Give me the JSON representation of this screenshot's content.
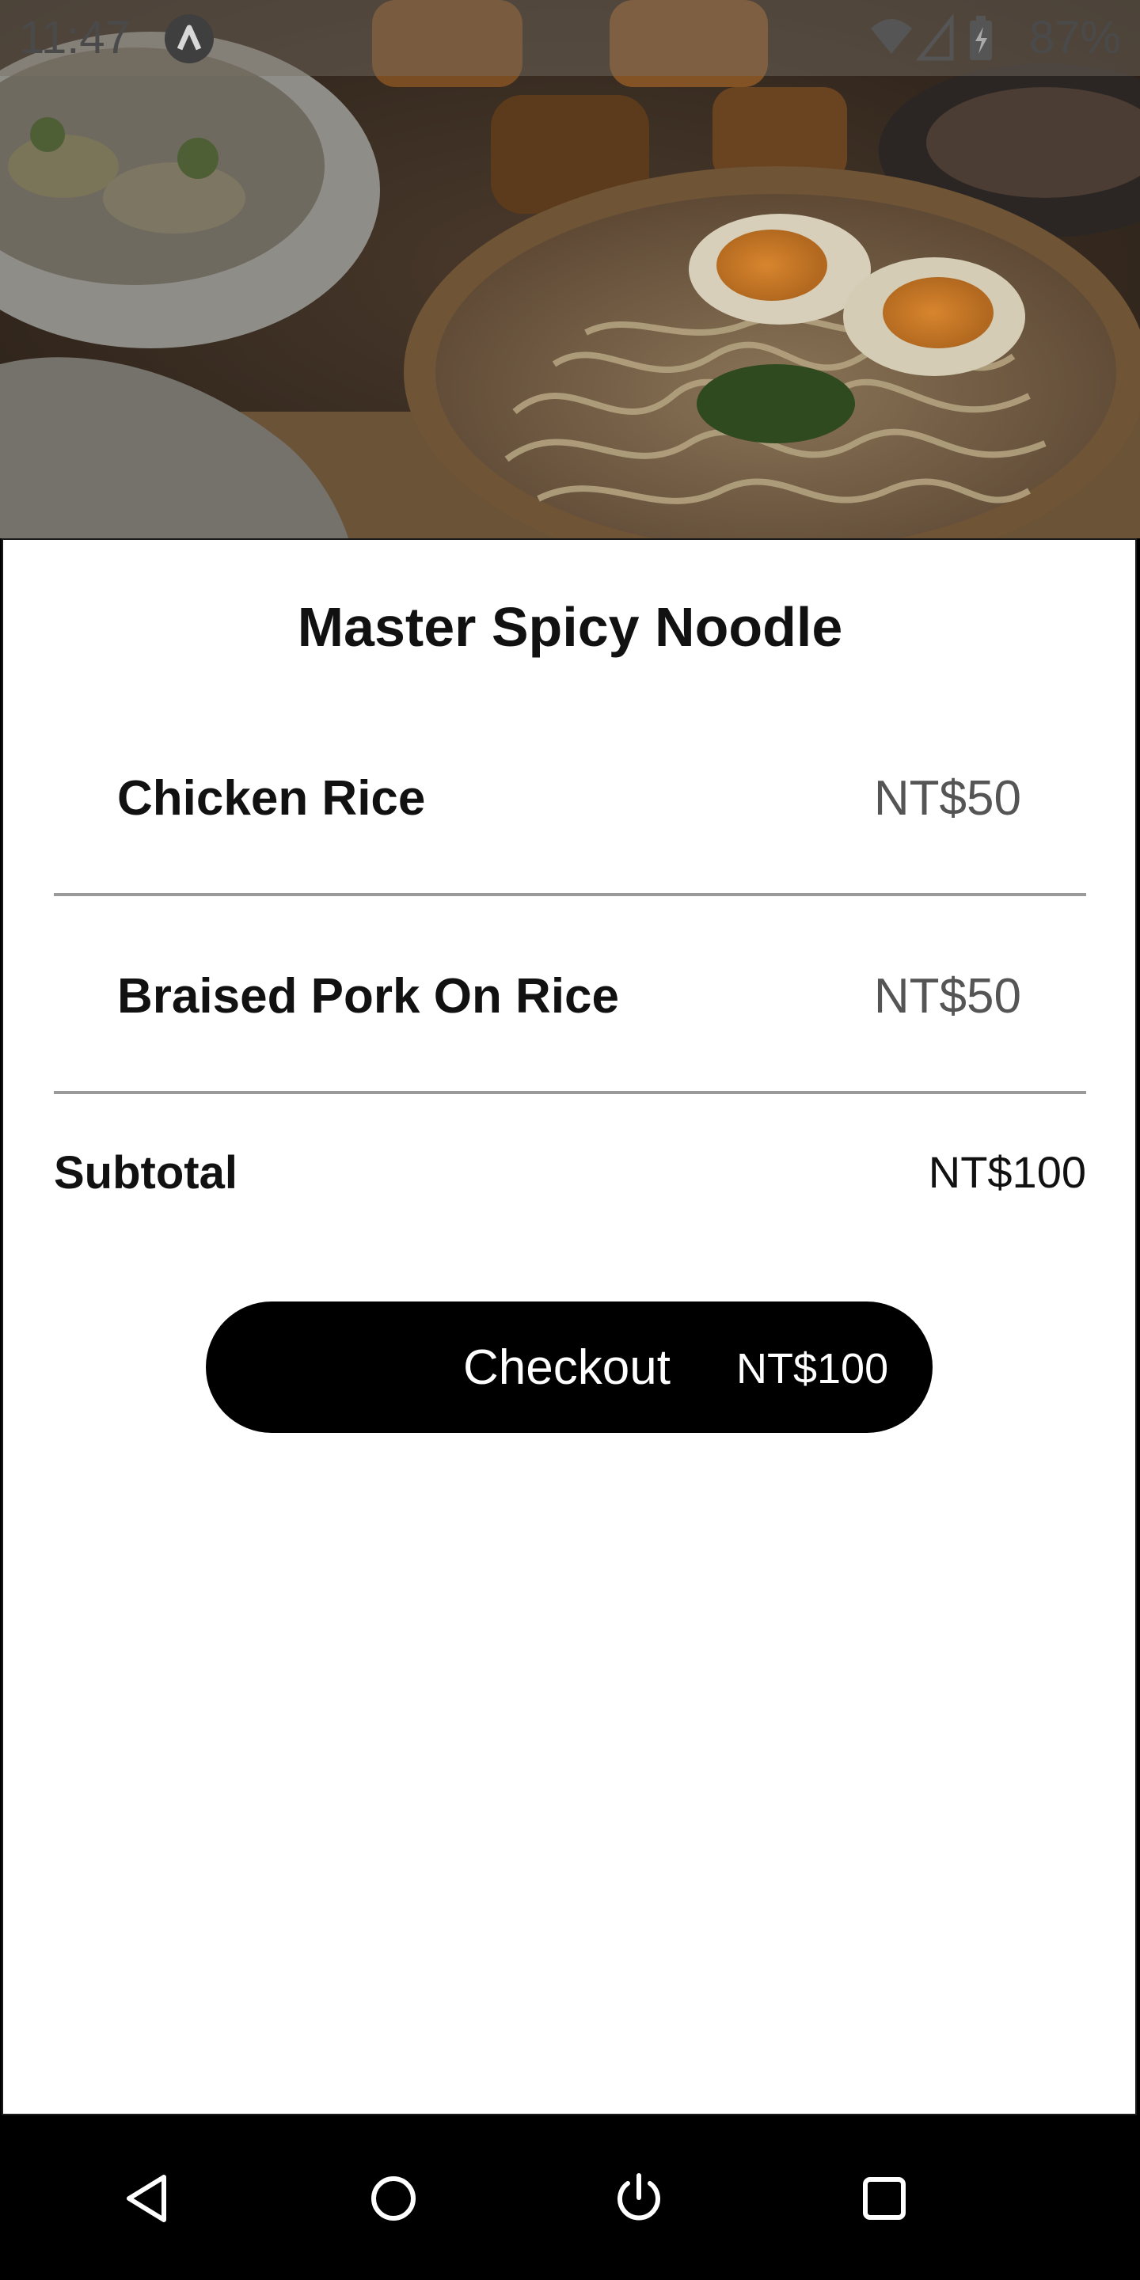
{
  "status_bar": {
    "time": "11:47",
    "battery_text": "87%",
    "icons": [
      "app-notification-icon",
      "wifi-icon",
      "signal-icon",
      "battery-charging-icon"
    ]
  },
  "hero": {
    "image": "noodle-bowl-with-soft-boiled-eggs-photo"
  },
  "cart": {
    "restaurant_name": "Master Spicy Noodle",
    "items": [
      {
        "name": "Chicken Rice",
        "price": "NT$50"
      },
      {
        "name": "Braised Pork On Rice",
        "price": "NT$50"
      }
    ],
    "subtotal_label": "Subtotal",
    "subtotal_value": "NT$100",
    "checkout_label": "Checkout",
    "checkout_total": "NT$100"
  },
  "nav_bar": {
    "buttons": [
      "back-icon",
      "home-icon",
      "power-icon",
      "recents-icon"
    ]
  },
  "colors": {
    "sheet_background": "#ffffff",
    "checkout_background": "#000000",
    "checkout_text": "#ffffff",
    "price_text": "#555555",
    "divider": "#9a9a9a"
  }
}
